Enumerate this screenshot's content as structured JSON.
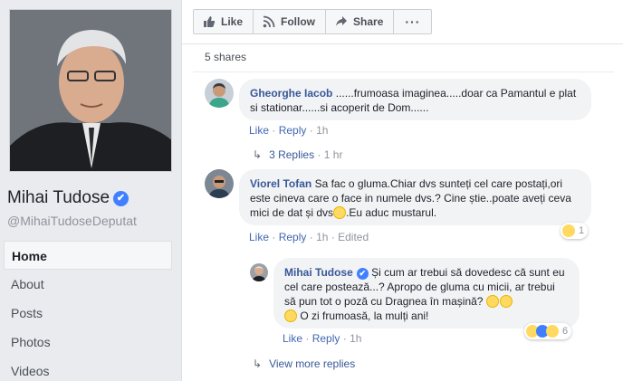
{
  "profile": {
    "name": "Mihai Tudose",
    "verified_mark": "✔",
    "handle": "@MihaiTudoseDeputat"
  },
  "nav": {
    "items": [
      {
        "label": "Home",
        "active": true
      },
      {
        "label": "About",
        "active": false
      },
      {
        "label": "Posts",
        "active": false
      },
      {
        "label": "Photos",
        "active": false
      },
      {
        "label": "Videos",
        "active": false
      }
    ]
  },
  "actions": {
    "like_label": "Like",
    "follow_label": "Follow",
    "share_label": "Share",
    "more_label": "···"
  },
  "shares_text": "5 shares",
  "comments": [
    {
      "author": "Gheorghe Iacob",
      "text": " ......frumoasa imaginea.....doar ca Pamantul e plat si stationar......si acoperit de Dom......",
      "like": "Like",
      "reply": "Reply",
      "time": "1h",
      "replies_label": "3 Replies",
      "replies_time": "1 hr"
    },
    {
      "author": "Viorel Tofan",
      "text_before": " Sa fac o gluma.Chiar dvs sunteți cel care postați,ori este cineva care o face in numele dvs.? Cine știe..poate aveți ceva mici de dat și dvs",
      "text_after": ".Eu aduc mustarul.",
      "like": "Like",
      "reply": "Reply",
      "time": "1h",
      "edited": "Edited",
      "reaction_count": "1"
    }
  ],
  "reply": {
    "author": "Mihai Tudose",
    "verified_mark": "✔",
    "text_line1": " Și cum ar trebui să dovedesc că sunt eu cel care postează...? Apropo de gluma cu micii, ar trebui să pun tot o poză cu Dragnea în mașină? ",
    "text_line2": " O zi frumoasă, la mulți ani!",
    "like": "Like",
    "reply": "Reply",
    "time": "1h",
    "reaction_count": "6"
  },
  "view_more_replies": "View more replies",
  "colors": {
    "link": "#385898",
    "bubble": "#f2f3f5",
    "meta": "#90949c",
    "verified": "#4080ff"
  },
  "icons": [
    "like-thumb-icon",
    "follow-rss-icon",
    "share-arrow-icon",
    "more-dots-icon",
    "reply-arrow-icon",
    "laugh-emoji-icon",
    "verified-badge-icon"
  ]
}
